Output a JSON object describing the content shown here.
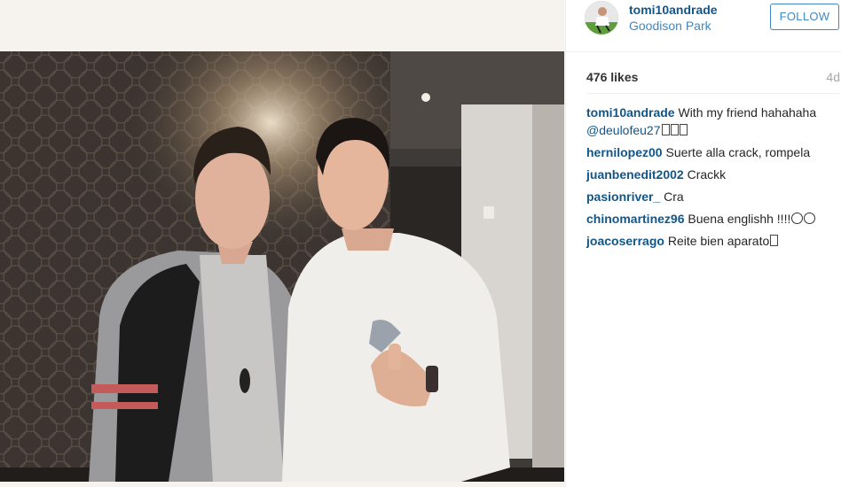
{
  "post": {
    "author": "tomi10andrade",
    "location": "Goodison Park",
    "follow_label": "FOLLOW",
    "likes": "476 likes",
    "age": "4d"
  },
  "caption": {
    "user": "tomi10andrade",
    "text": "With my friend hahahaha",
    "mention": "@deulofeu27"
  },
  "comments": [
    {
      "user": "hernilopez00",
      "text": "Suerte alla crack, rompela"
    },
    {
      "user": "juanbenedit2002",
      "text": "Crackk"
    },
    {
      "user": "pasionriver_",
      "text": "Cra"
    },
    {
      "user": "chinomartinez96",
      "text": "Buena englishh !!!!"
    },
    {
      "user": "joacoserrago",
      "text": "Reite bien aparato"
    }
  ],
  "colors": {
    "link": "#125688",
    "accent": "#3f88c5",
    "muted": "#a5a7aa"
  },
  "icons": {
    "avatar": "profile-photo",
    "photo": "two-people-photo"
  }
}
